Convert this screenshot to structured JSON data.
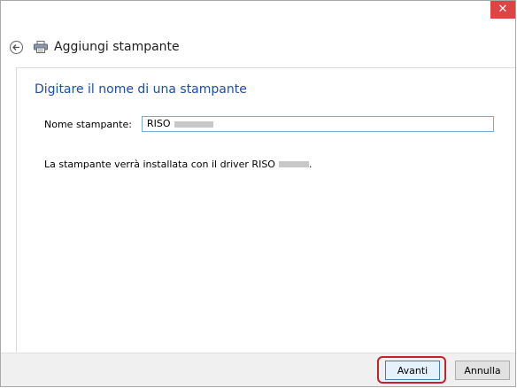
{
  "titlebar": {
    "close_label": "✕"
  },
  "header": {
    "title": "Aggiungi stampante"
  },
  "main": {
    "heading": "Digitare il nome di una stampante",
    "name_label": "Nome stampante:",
    "name_value": "RISO",
    "info_prefix": "La stampante verrà installata con il driver RISO",
    "info_suffix": "."
  },
  "footer": {
    "next_label": "Avanti",
    "cancel_label": "Annulla"
  },
  "colors": {
    "accent_heading": "#1b4fa8",
    "close_button": "#e04343",
    "highlight": "#c3222b"
  },
  "icons": [
    "back-arrow-icon",
    "printer-icon",
    "close-icon"
  ]
}
